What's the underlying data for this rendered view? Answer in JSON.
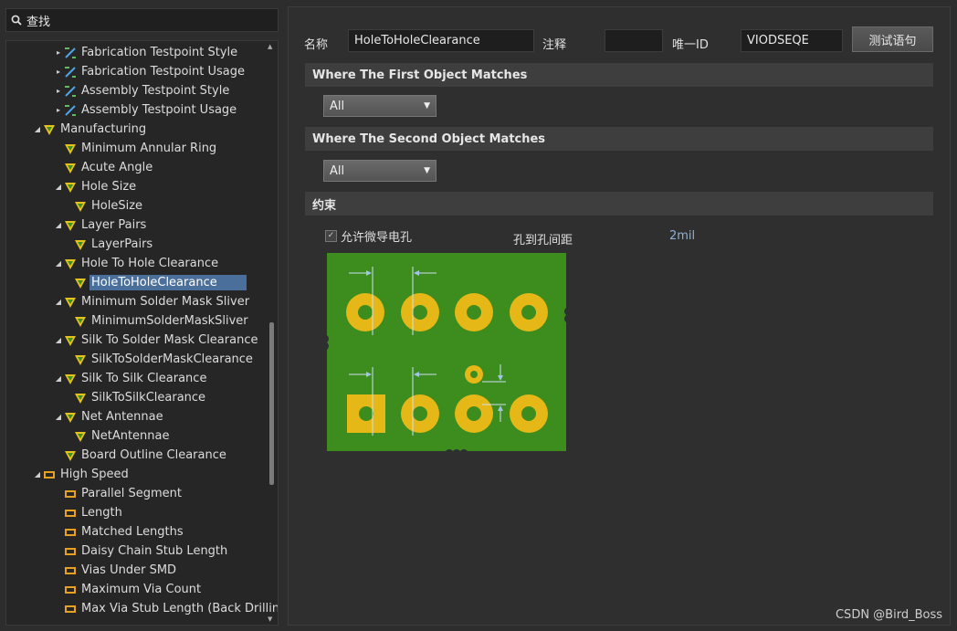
{
  "search": {
    "label": "查找"
  },
  "tree": [
    {
      "label": "Fabrication Testpoint Style",
      "indent": 2,
      "expander": "▸",
      "icon": "testpoint-icon"
    },
    {
      "label": "Fabrication Testpoint Usage",
      "indent": 2,
      "expander": "▸",
      "icon": "testpoint-icon"
    },
    {
      "label": "Assembly Testpoint Style",
      "indent": 2,
      "expander": "▸",
      "icon": "testpoint-icon"
    },
    {
      "label": "Assembly Testpoint Usage",
      "indent": 2,
      "expander": "▸",
      "icon": "testpoint-icon"
    },
    {
      "label": "Manufacturing",
      "indent": 1,
      "expander": "◢",
      "icon": "rule-icon"
    },
    {
      "label": "Minimum Annular Ring",
      "indent": 2,
      "expander": "",
      "icon": "rule-icon"
    },
    {
      "label": "Acute Angle",
      "indent": 2,
      "expander": "",
      "icon": "rule-icon"
    },
    {
      "label": "Hole Size",
      "indent": 2,
      "expander": "◢",
      "icon": "rule-icon"
    },
    {
      "label": "HoleSize",
      "indent": 3,
      "expander": "",
      "icon": "rule-icon"
    },
    {
      "label": "Layer Pairs",
      "indent": 2,
      "expander": "◢",
      "icon": "rule-icon"
    },
    {
      "label": "LayerPairs",
      "indent": 3,
      "expander": "",
      "icon": "rule-icon"
    },
    {
      "label": "Hole To Hole Clearance",
      "indent": 2,
      "expander": "◢",
      "icon": "rule-icon"
    },
    {
      "label": "HoleToHoleClearance",
      "indent": 3,
      "expander": "",
      "icon": "rule-icon",
      "selected": true
    },
    {
      "label": "Minimum Solder Mask Sliver",
      "indent": 2,
      "expander": "◢",
      "icon": "rule-icon"
    },
    {
      "label": "MinimumSolderMaskSliver",
      "indent": 3,
      "expander": "",
      "icon": "rule-icon"
    },
    {
      "label": "Silk To Solder Mask Clearance",
      "indent": 2,
      "expander": "◢",
      "icon": "rule-icon"
    },
    {
      "label": "SilkToSolderMaskClearance",
      "indent": 3,
      "expander": "",
      "icon": "rule-icon"
    },
    {
      "label": "Silk To Silk Clearance",
      "indent": 2,
      "expander": "◢",
      "icon": "rule-icon"
    },
    {
      "label": "SilkToSilkClearance",
      "indent": 3,
      "expander": "",
      "icon": "rule-icon"
    },
    {
      "label": "Net Antennae",
      "indent": 2,
      "expander": "◢",
      "icon": "rule-icon"
    },
    {
      "label": "NetAntennae",
      "indent": 3,
      "expander": "",
      "icon": "rule-icon"
    },
    {
      "label": "Board Outline Clearance",
      "indent": 2,
      "expander": "",
      "icon": "rule-icon"
    },
    {
      "label": "High Speed",
      "indent": 1,
      "expander": "◢",
      "icon": "highspeed-icon"
    },
    {
      "label": "Parallel Segment",
      "indent": 2,
      "expander": "",
      "icon": "highspeed-icon"
    },
    {
      "label": "Length",
      "indent": 2,
      "expander": "",
      "icon": "highspeed-icon"
    },
    {
      "label": "Matched Lengths",
      "indent": 2,
      "expander": "",
      "icon": "highspeed-icon"
    },
    {
      "label": "Daisy Chain Stub Length",
      "indent": 2,
      "expander": "",
      "icon": "highspeed-icon"
    },
    {
      "label": "Vias Under SMD",
      "indent": 2,
      "expander": "",
      "icon": "highspeed-icon"
    },
    {
      "label": "Maximum Via Count",
      "indent": 2,
      "expander": "",
      "icon": "highspeed-icon"
    },
    {
      "label": "Max Via Stub Length (Back Drilling)",
      "indent": 2,
      "expander": "",
      "icon": "highspeed-icon"
    }
  ],
  "form": {
    "name_label": "名称",
    "name_value": "HoleToHoleClearance",
    "comment_label": "注释",
    "comment_value": "",
    "uid_label": "唯一ID",
    "uid_value": "VIODSEQE",
    "test_button": "测试语句"
  },
  "first_match": {
    "title": "Where The First Object Matches",
    "value": "All"
  },
  "second_match": {
    "title": "Where The Second Object Matches",
    "value": "All"
  },
  "constraints": {
    "title": "约束",
    "allow_microvia_label": "允许微导电孔",
    "allow_microvia_checked": true,
    "hole_clearance_label": "孔到孔间距",
    "hole_clearance_value": "2mil"
  },
  "colors": {
    "board": "#3c8c1e",
    "pad": "#e6b817",
    "selection": "#4a6f9a"
  },
  "watermark": "CSDN @Bird_Boss"
}
